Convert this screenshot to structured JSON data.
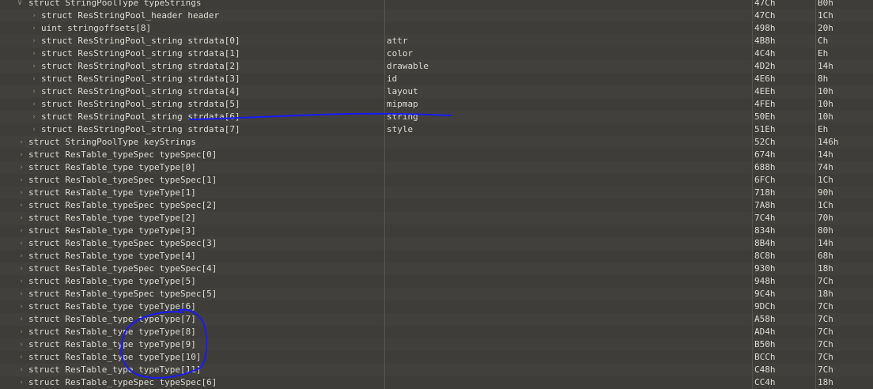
{
  "rows": [
    {
      "name": "struct StringPoolType typeStrings",
      "value": "",
      "start": "47Ch",
      "size": "B0h",
      "level": 0,
      "expanded": true
    },
    {
      "name": "struct ResStringPool_header header",
      "value": "",
      "start": "47Ch",
      "size": "1Ch",
      "level": 1
    },
    {
      "name": "uint stringoffsets[8]",
      "value": "",
      "start": "498h",
      "size": "20h",
      "level": 1
    },
    {
      "name": "struct ResStringPool_string strdata[0]",
      "value": "attr",
      "start": "4B8h",
      "size": "Ch",
      "level": 1
    },
    {
      "name": "struct ResStringPool_string strdata[1]",
      "value": "color",
      "start": "4C4h",
      "size": "Eh",
      "level": 1
    },
    {
      "name": "struct ResStringPool_string strdata[2]",
      "value": "drawable",
      "start": "4D2h",
      "size": "14h",
      "level": 1
    },
    {
      "name": "struct ResStringPool_string strdata[3]",
      "value": "id",
      "start": "4E6h",
      "size": "8h",
      "level": 1
    },
    {
      "name": "struct ResStringPool_string strdata[4]",
      "value": "layout",
      "start": "4EEh",
      "size": "10h",
      "level": 1
    },
    {
      "name": "struct ResStringPool_string strdata[5]",
      "value": "mipmap",
      "start": "4FEh",
      "size": "10h",
      "level": 1
    },
    {
      "name": "struct ResStringPool_string strdata[6]",
      "value": "string",
      "start": "50Eh",
      "size": "10h",
      "level": 1
    },
    {
      "name": "struct ResStringPool_string strdata[7]",
      "value": "style",
      "start": "51Eh",
      "size": "Eh",
      "level": 1
    },
    {
      "name": "struct StringPoolType keyStrings",
      "value": "",
      "start": "52Ch",
      "size": "146h",
      "level": 0
    },
    {
      "name": "struct ResTable_typeSpec typeSpec[0]",
      "value": "",
      "start": "674h",
      "size": "14h",
      "level": 0
    },
    {
      "name": "struct ResTable_type typeType[0]",
      "value": "",
      "start": "688h",
      "size": "74h",
      "level": 0
    },
    {
      "name": "struct ResTable_typeSpec typeSpec[1]",
      "value": "",
      "start": "6FCh",
      "size": "1Ch",
      "level": 0
    },
    {
      "name": "struct ResTable_type typeType[1]",
      "value": "",
      "start": "718h",
      "size": "90h",
      "level": 0
    },
    {
      "name": "struct ResTable_typeSpec typeSpec[2]",
      "value": "",
      "start": "7A8h",
      "size": "1Ch",
      "level": 0
    },
    {
      "name": "struct ResTable_type typeType[2]",
      "value": "",
      "start": "7C4h",
      "size": "70h",
      "level": 0
    },
    {
      "name": "struct ResTable_type typeType[3]",
      "value": "",
      "start": "834h",
      "size": "80h",
      "level": 0
    },
    {
      "name": "struct ResTable_typeSpec typeSpec[3]",
      "value": "",
      "start": "8B4h",
      "size": "14h",
      "level": 0
    },
    {
      "name": "struct ResTable_type typeType[4]",
      "value": "",
      "start": "8C8h",
      "size": "68h",
      "level": 0
    },
    {
      "name": "struct ResTable_typeSpec typeSpec[4]",
      "value": "",
      "start": "930h",
      "size": "18h",
      "level": 0
    },
    {
      "name": "struct ResTable_type typeType[5]",
      "value": "",
      "start": "948h",
      "size": "7Ch",
      "level": 0
    },
    {
      "name": "struct ResTable_typeSpec typeSpec[5]",
      "value": "",
      "start": "9C4h",
      "size": "18h",
      "level": 0
    },
    {
      "name": "struct ResTable_type typeType[6]",
      "value": "",
      "start": "9DCh",
      "size": "7Ch",
      "level": 0
    },
    {
      "name": "struct ResTable_type typeType[7]",
      "value": "",
      "start": "A58h",
      "size": "7Ch",
      "level": 0
    },
    {
      "name": "struct ResTable_type typeType[8]",
      "value": "",
      "start": "AD4h",
      "size": "7Ch",
      "level": 0
    },
    {
      "name": "struct ResTable_type typeType[9]",
      "value": "",
      "start": "B50h",
      "size": "7Ch",
      "level": 0
    },
    {
      "name": "struct ResTable_type typeType[10]",
      "value": "",
      "start": "BCCh",
      "size": "7Ch",
      "level": 0
    },
    {
      "name": "struct ResTable_type typeType[11]",
      "value": "",
      "start": "C48h",
      "size": "7Ch",
      "level": 0
    },
    {
      "name": "struct ResTable_typeSpec typeSpec[6]",
      "value": "",
      "start": "CC4h",
      "size": "18h",
      "level": 0
    }
  ],
  "icons": {
    "collapsed": "chevron-right-icon",
    "expanded": "chevron-down-icon"
  },
  "annotation_color": "#1a1aff"
}
